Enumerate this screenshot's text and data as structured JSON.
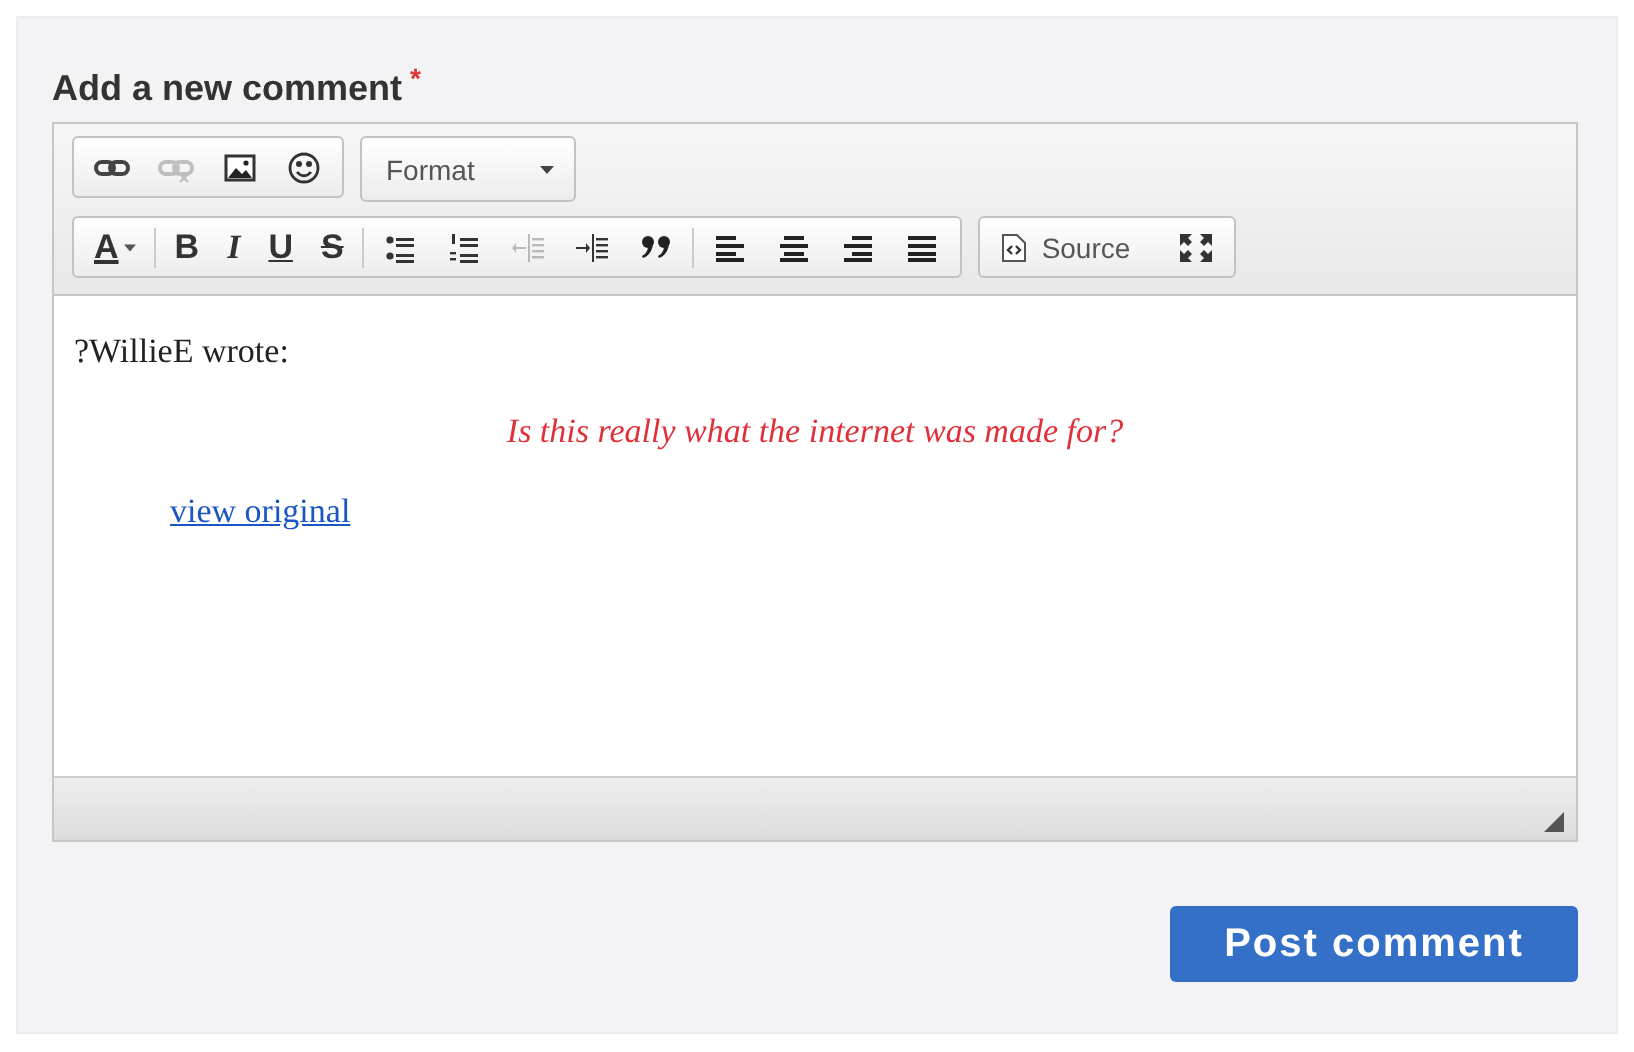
{
  "heading": {
    "label": "Add a new comment",
    "required_mark": "*"
  },
  "toolbar": {
    "rows": [
      {
        "groups": [
          {
            "kind": "buttons",
            "items": [
              {
                "kind": "link",
                "disabled": false
              },
              {
                "kind": "unlink",
                "disabled": true
              },
              {
                "kind": "image",
                "disabled": false
              },
              {
                "kind": "smiley",
                "disabled": false
              }
            ]
          },
          {
            "kind": "combo",
            "label": "Format"
          }
        ]
      },
      {
        "groups": [
          {
            "kind": "buttons",
            "items": [
              {
                "kind": "textcolor",
                "label": "A",
                "disabled": false
              },
              {
                "kind": "separator"
              },
              {
                "kind": "bold",
                "label": "B",
                "disabled": false
              },
              {
                "kind": "italic",
                "label": "I",
                "disabled": false
              },
              {
                "kind": "underline",
                "label": "U",
                "disabled": false
              },
              {
                "kind": "strike",
                "label": "S",
                "disabled": false
              },
              {
                "kind": "separator"
              },
              {
                "kind": "bulleted",
                "disabled": false
              },
              {
                "kind": "numbered",
                "disabled": false
              },
              {
                "kind": "outdent",
                "disabled": true
              },
              {
                "kind": "indent",
                "disabled": false
              },
              {
                "kind": "blockquote",
                "disabled": false
              },
              {
                "kind": "separator"
              },
              {
                "kind": "align-left",
                "disabled": false
              },
              {
                "kind": "align-center",
                "disabled": false
              },
              {
                "kind": "align-right",
                "disabled": false
              },
              {
                "kind": "justify",
                "disabled": false
              }
            ]
          },
          {
            "kind": "buttons",
            "items": [
              {
                "kind": "source",
                "label": "Source",
                "disabled": false
              },
              {
                "kind": "maximize",
                "disabled": false
              }
            ]
          }
        ]
      }
    ]
  },
  "editor": {
    "author_line": "?WillieE wrote:",
    "quote": "Is this really what the internet was made for?",
    "link": "view original"
  },
  "submit": {
    "label": "Post comment"
  }
}
